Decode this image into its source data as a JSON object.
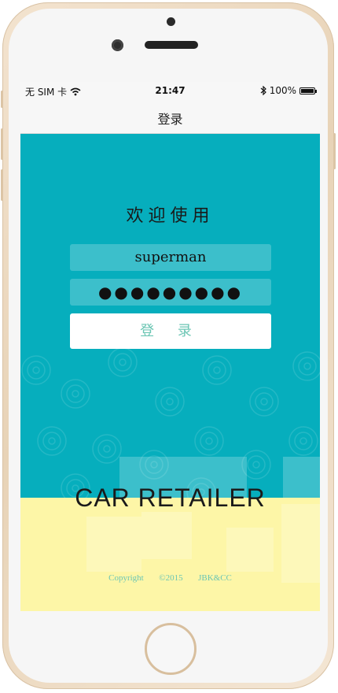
{
  "status_bar": {
    "carrier": "无 SIM 卡",
    "time": "21:47",
    "battery": "100%"
  },
  "nav": {
    "title": "登录"
  },
  "login": {
    "welcome": "欢迎使用",
    "username": "superman",
    "password_mask": "●●●●●●●●●",
    "button_label": "登 录"
  },
  "brand": {
    "name": "CAR RETAILER"
  },
  "footer": {
    "copyright_label": "Copyright",
    "year": "©2015",
    "company": "JBK&CC"
  },
  "colors": {
    "teal": "#06aebd",
    "yellow": "#fdf6a7",
    "accent_text": "#6cc6b4"
  },
  "icons": [
    "wifi-icon",
    "bluetooth-icon",
    "battery-icon"
  ]
}
